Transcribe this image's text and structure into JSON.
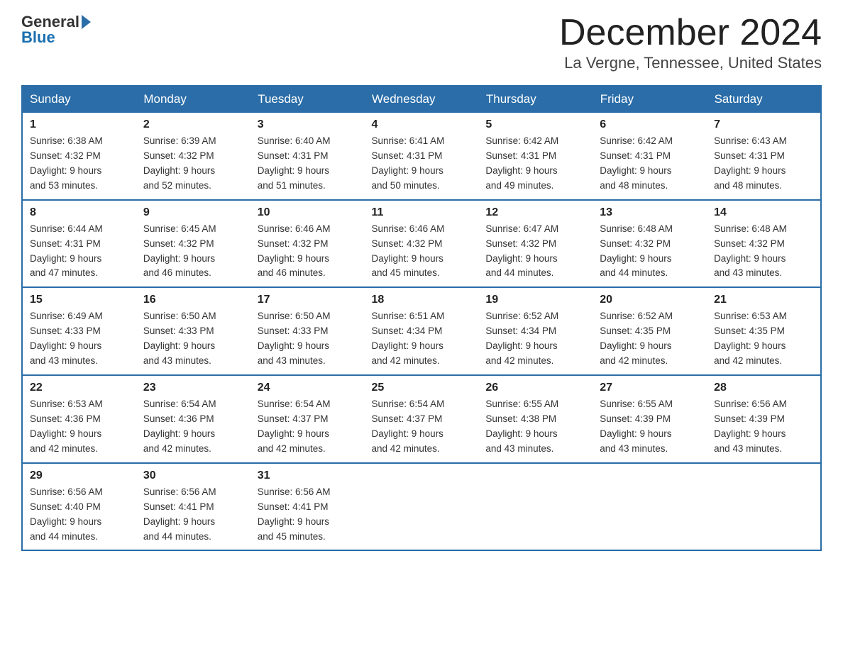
{
  "header": {
    "logo_general": "General",
    "logo_blue": "Blue",
    "month": "December 2024",
    "location": "La Vergne, Tennessee, United States"
  },
  "weekdays": [
    "Sunday",
    "Monday",
    "Tuesday",
    "Wednesday",
    "Thursday",
    "Friday",
    "Saturday"
  ],
  "weeks": [
    [
      {
        "day": "1",
        "sunrise": "6:38 AM",
        "sunset": "4:32 PM",
        "daylight": "9 hours and 53 minutes."
      },
      {
        "day": "2",
        "sunrise": "6:39 AM",
        "sunset": "4:32 PM",
        "daylight": "9 hours and 52 minutes."
      },
      {
        "day": "3",
        "sunrise": "6:40 AM",
        "sunset": "4:31 PM",
        "daylight": "9 hours and 51 minutes."
      },
      {
        "day": "4",
        "sunrise": "6:41 AM",
        "sunset": "4:31 PM",
        "daylight": "9 hours and 50 minutes."
      },
      {
        "day": "5",
        "sunrise": "6:42 AM",
        "sunset": "4:31 PM",
        "daylight": "9 hours and 49 minutes."
      },
      {
        "day": "6",
        "sunrise": "6:42 AM",
        "sunset": "4:31 PM",
        "daylight": "9 hours and 48 minutes."
      },
      {
        "day": "7",
        "sunrise": "6:43 AM",
        "sunset": "4:31 PM",
        "daylight": "9 hours and 48 minutes."
      }
    ],
    [
      {
        "day": "8",
        "sunrise": "6:44 AM",
        "sunset": "4:31 PM",
        "daylight": "9 hours and 47 minutes."
      },
      {
        "day": "9",
        "sunrise": "6:45 AM",
        "sunset": "4:32 PM",
        "daylight": "9 hours and 46 minutes."
      },
      {
        "day": "10",
        "sunrise": "6:46 AM",
        "sunset": "4:32 PM",
        "daylight": "9 hours and 46 minutes."
      },
      {
        "day": "11",
        "sunrise": "6:46 AM",
        "sunset": "4:32 PM",
        "daylight": "9 hours and 45 minutes."
      },
      {
        "day": "12",
        "sunrise": "6:47 AM",
        "sunset": "4:32 PM",
        "daylight": "9 hours and 44 minutes."
      },
      {
        "day": "13",
        "sunrise": "6:48 AM",
        "sunset": "4:32 PM",
        "daylight": "9 hours and 44 minutes."
      },
      {
        "day": "14",
        "sunrise": "6:48 AM",
        "sunset": "4:32 PM",
        "daylight": "9 hours and 43 minutes."
      }
    ],
    [
      {
        "day": "15",
        "sunrise": "6:49 AM",
        "sunset": "4:33 PM",
        "daylight": "9 hours and 43 minutes."
      },
      {
        "day": "16",
        "sunrise": "6:50 AM",
        "sunset": "4:33 PM",
        "daylight": "9 hours and 43 minutes."
      },
      {
        "day": "17",
        "sunrise": "6:50 AM",
        "sunset": "4:33 PM",
        "daylight": "9 hours and 43 minutes."
      },
      {
        "day": "18",
        "sunrise": "6:51 AM",
        "sunset": "4:34 PM",
        "daylight": "9 hours and 42 minutes."
      },
      {
        "day": "19",
        "sunrise": "6:52 AM",
        "sunset": "4:34 PM",
        "daylight": "9 hours and 42 minutes."
      },
      {
        "day": "20",
        "sunrise": "6:52 AM",
        "sunset": "4:35 PM",
        "daylight": "9 hours and 42 minutes."
      },
      {
        "day": "21",
        "sunrise": "6:53 AM",
        "sunset": "4:35 PM",
        "daylight": "9 hours and 42 minutes."
      }
    ],
    [
      {
        "day": "22",
        "sunrise": "6:53 AM",
        "sunset": "4:36 PM",
        "daylight": "9 hours and 42 minutes."
      },
      {
        "day": "23",
        "sunrise": "6:54 AM",
        "sunset": "4:36 PM",
        "daylight": "9 hours and 42 minutes."
      },
      {
        "day": "24",
        "sunrise": "6:54 AM",
        "sunset": "4:37 PM",
        "daylight": "9 hours and 42 minutes."
      },
      {
        "day": "25",
        "sunrise": "6:54 AM",
        "sunset": "4:37 PM",
        "daylight": "9 hours and 42 minutes."
      },
      {
        "day": "26",
        "sunrise": "6:55 AM",
        "sunset": "4:38 PM",
        "daylight": "9 hours and 43 minutes."
      },
      {
        "day": "27",
        "sunrise": "6:55 AM",
        "sunset": "4:39 PM",
        "daylight": "9 hours and 43 minutes."
      },
      {
        "day": "28",
        "sunrise": "6:56 AM",
        "sunset": "4:39 PM",
        "daylight": "9 hours and 43 minutes."
      }
    ],
    [
      {
        "day": "29",
        "sunrise": "6:56 AM",
        "sunset": "4:40 PM",
        "daylight": "9 hours and 44 minutes."
      },
      {
        "day": "30",
        "sunrise": "6:56 AM",
        "sunset": "4:41 PM",
        "daylight": "9 hours and 44 minutes."
      },
      {
        "day": "31",
        "sunrise": "6:56 AM",
        "sunset": "4:41 PM",
        "daylight": "9 hours and 45 minutes."
      },
      null,
      null,
      null,
      null
    ]
  ]
}
